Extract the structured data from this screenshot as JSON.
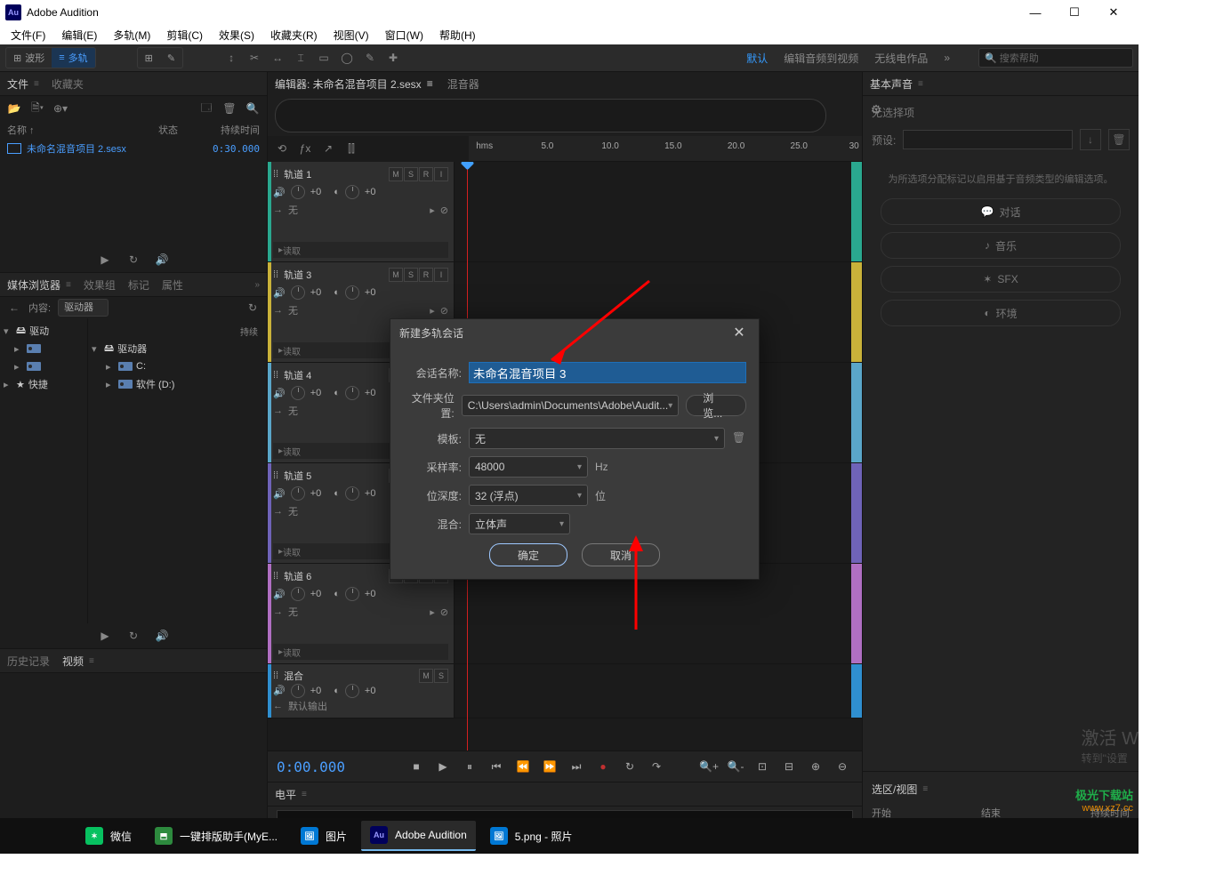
{
  "app": {
    "title": "Adobe Audition",
    "logo": "Au"
  },
  "winbuttons": {
    "min": "—",
    "max": "☐",
    "close": "✕"
  },
  "menubar": [
    "文件(F)",
    "编辑(E)",
    "多轨(M)",
    "剪辑(C)",
    "效果(S)",
    "收藏夹(R)",
    "视图(V)",
    "窗口(W)",
    "帮助(H)"
  ],
  "toolbar": {
    "waveform": "波形",
    "multitrack": "多轨"
  },
  "workspaces": {
    "default": "默认",
    "editAV": "编辑音频到视频",
    "radio": "无线电作品",
    "more": "»",
    "search_placeholder": "搜索帮助"
  },
  "filesPanel": {
    "tabs": [
      "文件",
      "收藏夹"
    ],
    "cols": {
      "name": "名称 ↑",
      "status": "状态",
      "duration": "持续时间"
    },
    "items": [
      {
        "name": "未命名混音项目 2.sesx",
        "duration": "0:30.000"
      }
    ]
  },
  "mediaBrowser": {
    "tabs": [
      "媒体浏览器",
      "效果组",
      "标记",
      "属性"
    ],
    "contentLabel": "内容:",
    "drivesLabel": "驱动器",
    "leftTree": [
      {
        "label": "驱动",
        "expandable": true
      },
      {
        "label": "快捷",
        "expandable": true
      }
    ],
    "rightTree": [
      {
        "label": "驱动器",
        "expandable": true,
        "children": [
          {
            "label": "C:"
          },
          {
            "label": "软件 (D:)"
          }
        ]
      }
    ],
    "rightHeader": "持续"
  },
  "historyPanel": {
    "tabs": [
      "历史记录",
      "视频"
    ]
  },
  "editor": {
    "tabs": {
      "editor": "编辑器: 未命名混音项目 2.sesx",
      "mixer": "混音器"
    },
    "ruler": [
      "hms",
      "5.0",
      "10.0",
      "15.0",
      "20.0",
      "25.0",
      "30"
    ],
    "tracks": [
      {
        "name": "轨道 1",
        "color": "#2aa88f"
      },
      {
        "name": "轨道 3",
        "color": "#c9b23a"
      },
      {
        "name": "轨道 4",
        "color": "#5aa6c9"
      },
      {
        "name": "轨道 5",
        "color": "#6f63b8"
      },
      {
        "name": "轨道 6",
        "color": "#b06fc2"
      }
    ],
    "mixTrack": {
      "name": "混合",
      "color": "#2f8fd0"
    },
    "trackLabels": {
      "vol": "+0",
      "pan": "+0",
      "none": "无",
      "route": "默认输出",
      "read": "读取",
      "ms": [
        "M",
        "S",
        "R",
        "I"
      ]
    },
    "timecode": "0:00.000"
  },
  "levelPanel": {
    "tab": "电平"
  },
  "essentialSound": {
    "tab": "基本声音",
    "noSelection": "无选择项",
    "presetLabel": "预设:",
    "hint": "为所选项分配标记以启用基于音频类型的编辑选项。",
    "cats": [
      {
        "icon": "💬",
        "label": "对话"
      },
      {
        "icon": "♪",
        "label": "音乐"
      },
      {
        "icon": "✶",
        "label": "SFX"
      },
      {
        "icon": "◐",
        "label": "环境"
      }
    ]
  },
  "selPanel": {
    "tab": "选区/视图",
    "cols": [
      "开始",
      "结束",
      "持续时间"
    ]
  },
  "dialog": {
    "title": "新建多轨会话",
    "labels": {
      "name": "会话名称:",
      "folder": "文件夹位置:",
      "template": "模板:",
      "sr": "采样率:",
      "bit": "位深度:",
      "mix": "混合:"
    },
    "values": {
      "name": "未命名混音项目 3",
      "folder": "C:\\Users\\admin\\Documents\\Adobe\\Audit...",
      "template": "无",
      "sr": "48000",
      "bit": "32 (浮点)",
      "mix": "立体声"
    },
    "units": {
      "sr": "Hz",
      "bit": "位"
    },
    "browse": "浏览...",
    "ok": "确定",
    "cancel": "取消"
  },
  "taskbar": {
    "items": [
      {
        "icon": "wechat",
        "label": "微信",
        "color": "#07c160"
      },
      {
        "icon": "app",
        "label": "一键排版助手(MyE...",
        "color": "#2d8a3e"
      },
      {
        "icon": "photos",
        "label": "图片",
        "color": "#0078d4"
      },
      {
        "icon": "au",
        "label": "Adobe Audition",
        "color": "#00005b",
        "active": true
      },
      {
        "icon": "photos",
        "label": "5.png - 照片",
        "color": "#0078d4"
      }
    ]
  },
  "watermark": {
    "title": "激活 W",
    "sub": "转到\"设置"
  },
  "siteWm": {
    "name": "极光下载站",
    "url": "www.xz7.cc"
  }
}
